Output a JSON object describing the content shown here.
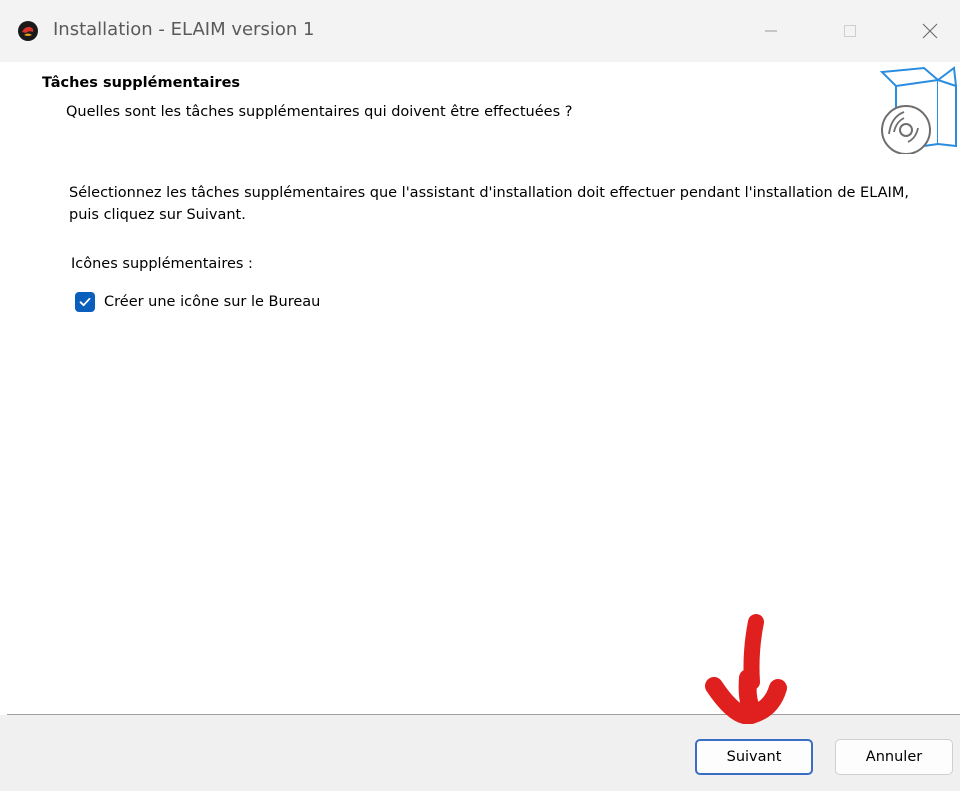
{
  "window": {
    "title": "Installation - ELAIM version 1",
    "app_icon": "app-logo-icon",
    "controls": [
      "minimize-icon",
      "maximize-icon",
      "close-icon"
    ]
  },
  "header": {
    "title": "Tâches supplémentaires",
    "subtitle": "Quelles sont les tâches supplémentaires qui doivent être effectuées ?",
    "graphic": "setup-box-disc-icon"
  },
  "content": {
    "instructions": "Sélectionnez les tâches supplémentaires que l'assistant d'installation doit effectuer pendant l'installation de ELAIM, puis cliquez sur Suivant.",
    "group_label": "Icônes supplémentaires :",
    "tasks": [
      {
        "label": "Créer une icône sur le Bureau",
        "checked": true
      }
    ]
  },
  "footer": {
    "next_label": "Suivant",
    "cancel_label": "Annuler"
  },
  "colors": {
    "accent": "#0a5fbd",
    "annotation": "#e0201f",
    "titlebar": "#f3f3f3",
    "footer": "#f0f0f0"
  },
  "annotation": {
    "icon": "red-hand-drawn-arrow-icon"
  }
}
